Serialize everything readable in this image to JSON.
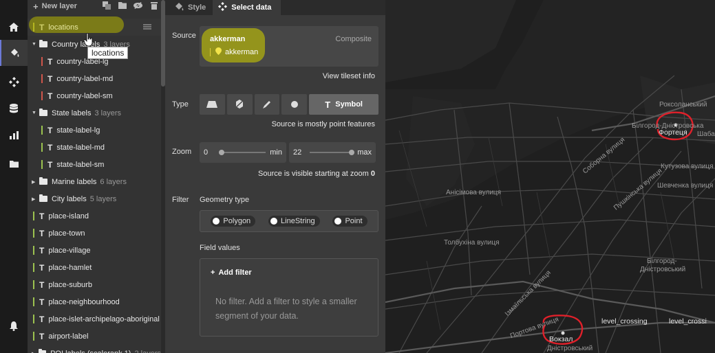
{
  "rail": {
    "items": [
      {
        "name": "home-icon"
      },
      {
        "name": "style-icon",
        "active": true
      },
      {
        "name": "components-icon"
      },
      {
        "name": "data-icon"
      },
      {
        "name": "stats-icon"
      },
      {
        "name": "folder-icon"
      },
      {
        "name": "notifications-icon"
      }
    ]
  },
  "layers": {
    "new_layer_label": "New layer",
    "tooltip": "locations",
    "items": [
      {
        "label": "locations",
        "kind": "symbol",
        "bar_color": "#b5b84a",
        "selected": true
      },
      {
        "label": "Country labels",
        "count": "3 layers",
        "kind": "group",
        "open": true
      },
      {
        "label": "country-label-lg",
        "kind": "symbol",
        "bar_color": "#d0564b",
        "indent": true
      },
      {
        "label": "country-label-md",
        "kind": "symbol",
        "bar_color": "#d0564b",
        "indent": true
      },
      {
        "label": "country-label-sm",
        "kind": "symbol",
        "bar_color": "#d0564b",
        "indent": true
      },
      {
        "label": "State labels",
        "count": "3 layers",
        "kind": "group",
        "open": true
      },
      {
        "label": "state-label-lg",
        "kind": "symbol",
        "bar_color": "#9cc34f",
        "indent": true
      },
      {
        "label": "state-label-md",
        "kind": "symbol",
        "bar_color": "#9cc34f",
        "indent": true
      },
      {
        "label": "state-label-sm",
        "kind": "symbol",
        "bar_color": "#9cc34f",
        "indent": true
      },
      {
        "label": "Marine labels",
        "count": "6 layers",
        "kind": "group",
        "open": false
      },
      {
        "label": "City labels",
        "count": "5 layers",
        "kind": "group",
        "open": false
      },
      {
        "label": "place-island",
        "kind": "symbol",
        "bar_color": "#9cc34f"
      },
      {
        "label": "place-town",
        "kind": "symbol",
        "bar_color": "#9cc34f"
      },
      {
        "label": "place-village",
        "kind": "symbol",
        "bar_color": "#9cc34f"
      },
      {
        "label": "place-hamlet",
        "kind": "symbol",
        "bar_color": "#9cc34f"
      },
      {
        "label": "place-suburb",
        "kind": "symbol",
        "bar_color": "#9cc34f"
      },
      {
        "label": "place-neighbourhood",
        "kind": "symbol",
        "bar_color": "#9cc34f"
      },
      {
        "label": "place-islet-archipelago-aboriginal",
        "kind": "symbol",
        "bar_color": "#9cc34f"
      },
      {
        "label": "airport-label",
        "kind": "symbol",
        "bar_color": "#9cc34f"
      },
      {
        "label": "POI labels (scalerank 1)",
        "count": "2 layers",
        "kind": "group",
        "open": false
      }
    ]
  },
  "editor": {
    "tabs": [
      {
        "label": "Style",
        "active": false
      },
      {
        "label": "Select data",
        "active": true
      }
    ],
    "source_label": "Source",
    "source_name": "akkerman",
    "source_layer": "akkerman",
    "source_kind": "Composite",
    "view_tileset_info": "View tileset info",
    "type_label": "Type",
    "type_active": "Symbol",
    "type_note": "Source is mostly point features",
    "zoom_label": "Zoom",
    "zoom_min_value": "0",
    "zoom_min_label": "min",
    "zoom_max_value": "22",
    "zoom_max_label": "max",
    "zoom_note": "Source is visible starting at zoom",
    "zoom_note_value": "0",
    "filter_label": "Filter",
    "geometry_type_label": "Geometry type",
    "geometry_types": [
      "Polygon",
      "LineString",
      "Point"
    ],
    "field_values_label": "Field values",
    "add_filter": "Add filter",
    "no_filter_text": "No filter. Add a filter to style a smaller segment of your data."
  },
  "map": {
    "labels": [
      {
        "text": "Роксоланський",
        "cls": ""
      },
      {
        "text": "Білгород-Дністровська",
        "cls": ""
      },
      {
        "text": "Фортеця",
        "cls": "bright"
      },
      {
        "text": "Шаба",
        "cls": ""
      },
      {
        "text": "Кутузова вулиця",
        "cls": ""
      },
      {
        "text": "Шевченка вулиця",
        "cls": ""
      },
      {
        "text": "Соборна вулиця",
        "cls": ""
      },
      {
        "text": "Пушкінська вулиця",
        "cls": ""
      },
      {
        "text": "Анісімова вулиця",
        "cls": ""
      },
      {
        "text": "Толбухіна вулиця",
        "cls": ""
      },
      {
        "text": "Білгород-",
        "cls": ""
      },
      {
        "text": "Дністровський",
        "cls": ""
      },
      {
        "text": "Ізмаїльська вулиця",
        "cls": ""
      },
      {
        "text": "Портова вулиця",
        "cls": ""
      },
      {
        "text": "Вокзал",
        "cls": "bright"
      },
      {
        "text": "Дністровський",
        "cls": ""
      },
      {
        "text": "level_crossing",
        "cls": "bright"
      },
      {
        "text": "level_crossi",
        "cls": "bright"
      }
    ]
  }
}
